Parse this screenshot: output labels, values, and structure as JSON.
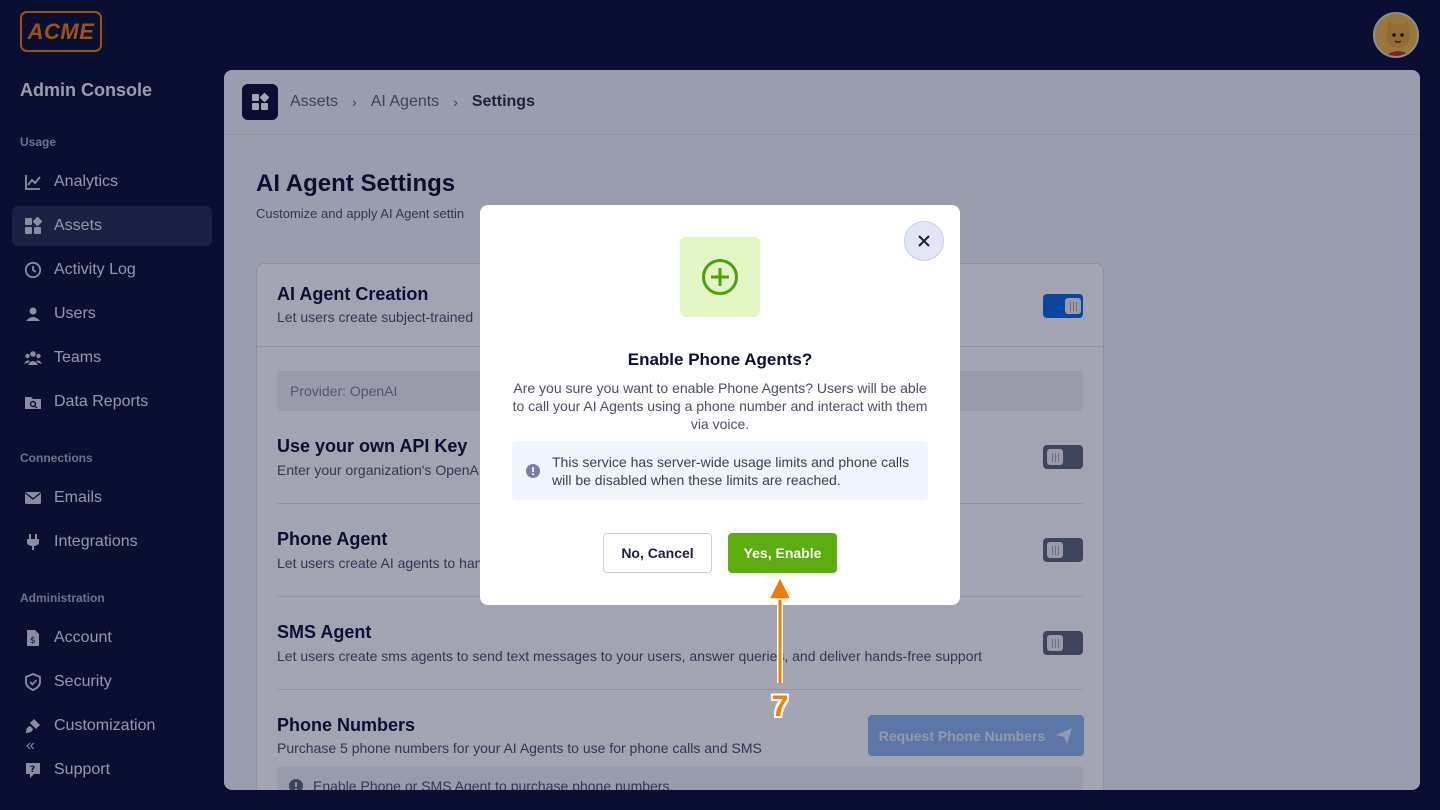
{
  "brand": {
    "logo_text": "ACME"
  },
  "sidebar": {
    "title": "Admin Console",
    "sections": [
      {
        "label": "Usage",
        "items": [
          {
            "label": "Analytics",
            "icon": "chart-line-icon"
          },
          {
            "label": "Assets",
            "icon": "grid-icon",
            "active": true
          },
          {
            "label": "Activity Log",
            "icon": "clock-icon"
          },
          {
            "label": "Users",
            "icon": "user-icon"
          },
          {
            "label": "Teams",
            "icon": "team-icon"
          },
          {
            "label": "Data Reports",
            "icon": "folder-search-icon"
          }
        ]
      },
      {
        "label": "Connections",
        "items": [
          {
            "label": "Emails",
            "icon": "mail-icon"
          },
          {
            "label": "Integrations",
            "icon": "plug-icon"
          }
        ]
      },
      {
        "label": "Administration",
        "items": [
          {
            "label": "Account",
            "icon": "document-icon"
          },
          {
            "label": "Security",
            "icon": "shield-icon"
          },
          {
            "label": "Customization",
            "icon": "brush-icon"
          },
          {
            "label": "Support",
            "icon": "help-icon"
          }
        ]
      }
    ],
    "collapse_glyph": "«"
  },
  "breadcrumb": [
    "Assets",
    "AI Agents",
    "Settings"
  ],
  "page": {
    "title": "AI Agent Settings",
    "subtitle": "Customize and apply AI Agent settin"
  },
  "settings": {
    "creation": {
      "title": "AI Agent Creation",
      "desc": "Let users create subject-trained",
      "enabled": true
    },
    "provider": "Provider: OpenAI",
    "api_key": {
      "title": "Use your own API Key",
      "desc": "Enter your organization's OpenA",
      "enabled": false
    },
    "phone_agent": {
      "title": "Phone Agent",
      "desc": "Let users create AI agents to han",
      "enabled": false
    },
    "sms_agent": {
      "title": "SMS Agent",
      "desc": "Let users create sms agents to send text messages to your users, answer queries, and deliver hands-free support",
      "enabled": false
    },
    "phone_numbers": {
      "title": "Phone Numbers",
      "desc": "Purchase 5 phone numbers for your AI Agents to use for phone calls and SMS",
      "button": "Request Phone Numbers"
    },
    "info": "Enable Phone or SMS Agent to purchase phone numbers."
  },
  "modal": {
    "title": "Enable Phone Agents?",
    "body": "Are you sure you want to enable Phone Agents? Users will be able to call your AI Agents using a phone number and interact with them via voice.",
    "note": "This service has server-wide usage limits and phone calls will be disabled when these limits are reached.",
    "cancel_label": "No, Cancel",
    "confirm_label": "Yes, Enable"
  },
  "annotation": {
    "step": "7",
    "color": "#f57b00"
  },
  "colors": {
    "accent_green": "#5cae0f",
    "toggle_on": "#0b66e4",
    "nav_bg": "#0a1033"
  }
}
